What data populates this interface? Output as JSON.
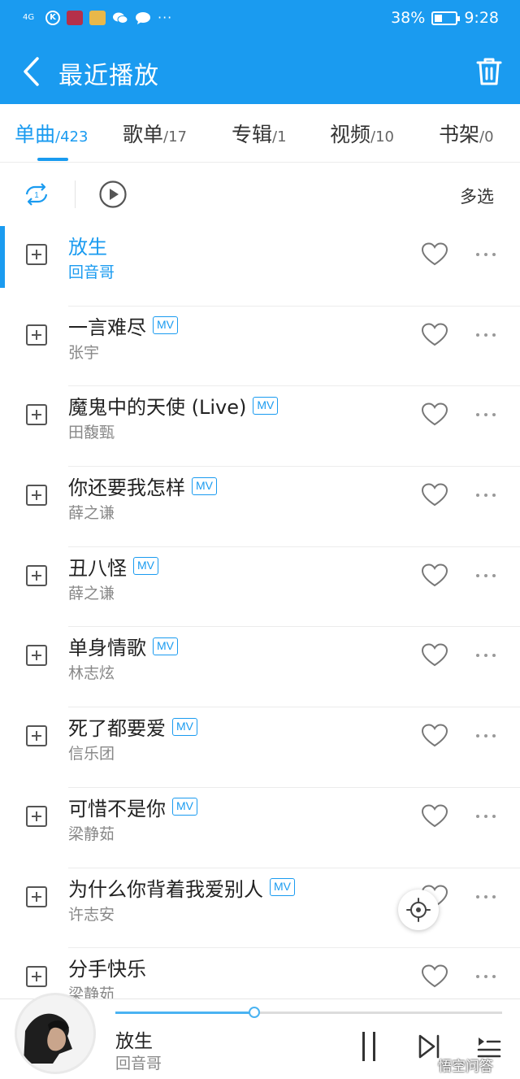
{
  "status_bar": {
    "network": "4G",
    "circle_letter": "K",
    "battery": "38%",
    "battery_level": 0.38,
    "time": "9:28",
    "overflow": "···"
  },
  "app_bar": {
    "title": "最近播放"
  },
  "tabs": [
    {
      "label": "单曲",
      "count": "/423",
      "active": true
    },
    {
      "label": "歌单",
      "count": "/17",
      "active": false
    },
    {
      "label": "专辑",
      "count": "/1",
      "active": false
    },
    {
      "label": "视频",
      "count": "/10",
      "active": false
    },
    {
      "label": "书架",
      "count": "/0",
      "active": false
    }
  ],
  "toolbar": {
    "repeat_badge": "1",
    "multi_select": "多选"
  },
  "songs": [
    {
      "title": "放生",
      "artist": "回音哥",
      "mv": false,
      "active": true
    },
    {
      "title": "一言难尽",
      "artist": "张宇",
      "mv": true,
      "active": false
    },
    {
      "title": "魔鬼中的天使 (Live)",
      "artist": "田馥甄",
      "mv": true,
      "active": false
    },
    {
      "title": "你还要我怎样",
      "artist": "薛之谦",
      "mv": true,
      "active": false
    },
    {
      "title": "丑八怪",
      "artist": "薛之谦",
      "mv": true,
      "active": false
    },
    {
      "title": "单身情歌",
      "artist": "林志炫",
      "mv": true,
      "active": false
    },
    {
      "title": "死了都要爱",
      "artist": "信乐团",
      "mv": true,
      "active": false
    },
    {
      "title": "可惜不是你",
      "artist": "梁静茹",
      "mv": true,
      "active": false
    },
    {
      "title": "为什么你背着我爱别人",
      "artist": "许志安",
      "mv": true,
      "active": false
    },
    {
      "title": "分手快乐",
      "artist": "梁静茹",
      "mv": false,
      "active": false
    }
  ],
  "mv_label": "MV",
  "player": {
    "title": "放生",
    "artist": "回音哥",
    "progress": 0.36
  },
  "watermark": "悟空问答",
  "colors": {
    "accent": "#1a9bf0",
    "text": "#222222",
    "secondary_text": "#888888"
  }
}
